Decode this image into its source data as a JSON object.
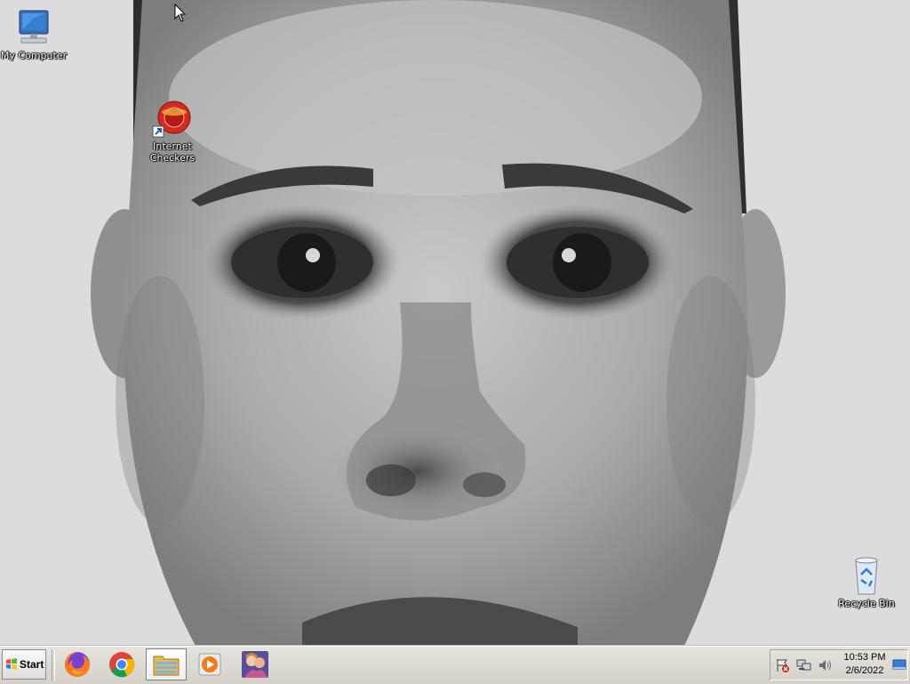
{
  "desktop": {
    "icons": [
      {
        "label": "My Computer",
        "icon": "computer-icon"
      },
      {
        "label": "Internet Checkers",
        "label_lines": [
          "Internet",
          "Checkers"
        ],
        "icon": "internet-checkers-icon"
      },
      {
        "label": "Recycle Bin",
        "icon": "recycle-bin-icon"
      }
    ],
    "wallpaper": "grayscale portrait drawing of a face"
  },
  "taskbar": {
    "start_label": "Start",
    "apps": [
      {
        "name": "Firefox",
        "icon": "firefox-icon"
      },
      {
        "name": "Google Chrome",
        "icon": "chrome-icon"
      },
      {
        "name": "File Explorer",
        "icon": "folder-icon",
        "active": true
      },
      {
        "name": "Media Player",
        "icon": "media-player-icon"
      },
      {
        "name": "Game",
        "icon": "game-icon"
      }
    ],
    "tray": {
      "icons": [
        "action-center-flag-icon",
        "network-icon",
        "volume-icon",
        "show-desktop-icon"
      ],
      "time": "10:53 PM",
      "date": "2/6/2022"
    }
  },
  "colors": {
    "desktop_bg": "#dcdcde",
    "taskbar_bg": "#d4d0c8"
  }
}
